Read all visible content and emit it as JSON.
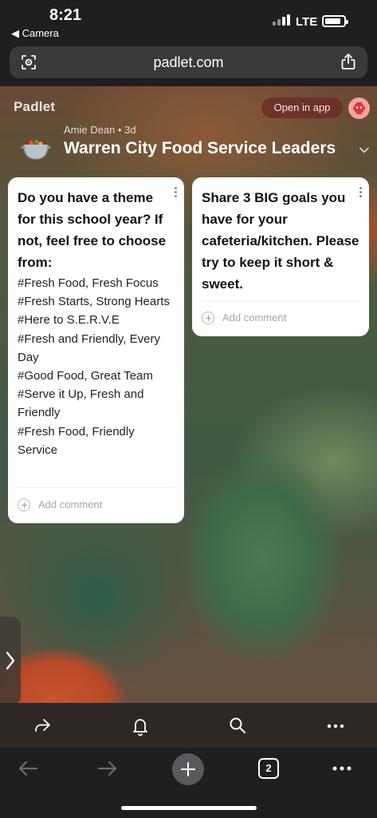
{
  "status_bar": {
    "time": "8:21",
    "back_app": "◀ Camera",
    "network": "LTE"
  },
  "browser": {
    "url": "padlet.com",
    "reader_icon": "page-settings-icon",
    "share_icon": "share-icon"
  },
  "padlet": {
    "logo": "Padlet",
    "open_in_app": "Open in app",
    "author_line": "Amie Dean • 3d",
    "board_title": "Warren City Food Service Leaders",
    "board_icon": "stew-pot-emoji"
  },
  "posts": [
    {
      "title": "Do you have a theme for this school year?  If not, feel free to choose from:",
      "body_lines": [
        "#Fresh Food, Fresh Focus",
        "#Fresh Starts, Strong Hearts",
        "#Here to S.E.R.V.E",
        "#Fresh and Friendly, Every Day",
        "#Good Food, Great Team",
        "#Serve it Up, Fresh and Friendly",
        "#Fresh Food, Friendly Service"
      ],
      "add_comment": "Add comment"
    },
    {
      "title": "Share 3 BIG goals you have for your cafeteria/kitchen. Please try to keep it short & sweet.",
      "add_comment": "Add comment"
    }
  ],
  "padlet_toolbar": {
    "icons": [
      "share-arrow-icon",
      "bell-icon",
      "search-icon",
      "more-icon"
    ]
  },
  "safari_toolbar": {
    "tab_count": "2",
    "icons": [
      "back-arrow-icon",
      "forward-arrow-icon",
      "new-tab-icon",
      "tabs-icon",
      "more-icon"
    ]
  },
  "colors": {
    "card_bg": "#ffffff",
    "open_app_bg": "#6e2823",
    "avatar_bg": "#f5a3a1",
    "toolbar_bg": "#2d2824"
  }
}
